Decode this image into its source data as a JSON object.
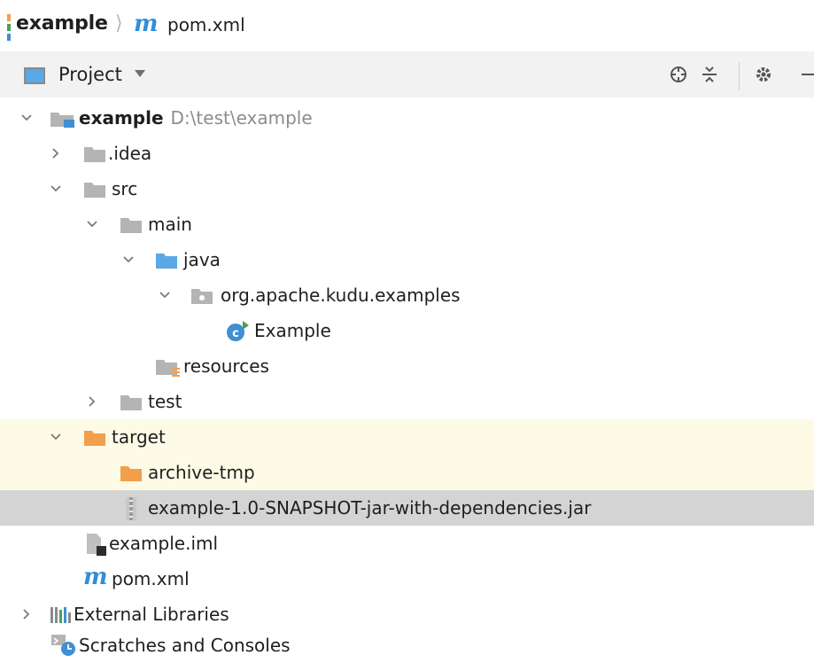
{
  "breadcrumb": {
    "project": "example",
    "file": "pom.xml",
    "maven_glyph": "m"
  },
  "toolbar": {
    "view_label": "Project"
  },
  "tree": {
    "root": {
      "label": "example",
      "path": "D:\\test\\example"
    },
    "idea": "idea",
    "src": "src",
    "main": "main",
    "java": "java",
    "package": "org.apache.kudu.examples",
    "class": "Example",
    "class_glyph": "c",
    "resources": "resources",
    "test": "test",
    "target": "target",
    "archive": "archive-tmp",
    "jar": "example-1.0-SNAPSHOT-jar-with-dependencies.jar",
    "iml": "example.iml",
    "pom": "pom.xml",
    "external": "External Libraries",
    "scratches": "Scratches and Consoles"
  },
  "colors": {
    "folder_gray": "#b4b4b4",
    "folder_blue": "#5aa9e6",
    "folder_orange": "#f29f4b",
    "maven_blue": "#2f8fd8",
    "selection_gray": "#d4d4d4",
    "excluded_yellow": "#fdfbe6",
    "class_blue": "#3f8fd2"
  }
}
